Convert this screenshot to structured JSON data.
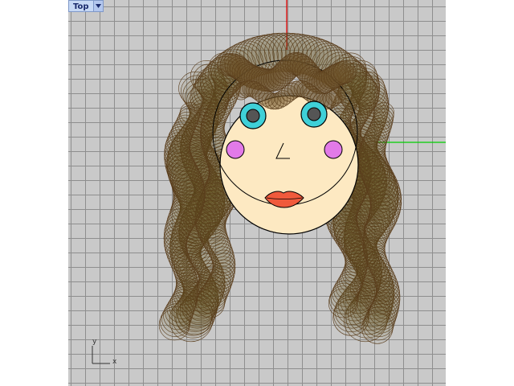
{
  "viewport": {
    "view_name": "Top",
    "view_menu_icon": "triangle-down-icon",
    "axes": {
      "x_label": "x",
      "y_label": "y"
    },
    "colors": {
      "background": "#c9c9c9",
      "grid": "#8e8e8e",
      "world_x_axis": "#00d000",
      "world_y_axis": "#e00000",
      "hair": "#5a3d1c",
      "skin": "#fde9c2",
      "iris": "#3fd0d8",
      "cheek": "#e27ae8",
      "lips": "#f05a3c"
    }
  }
}
